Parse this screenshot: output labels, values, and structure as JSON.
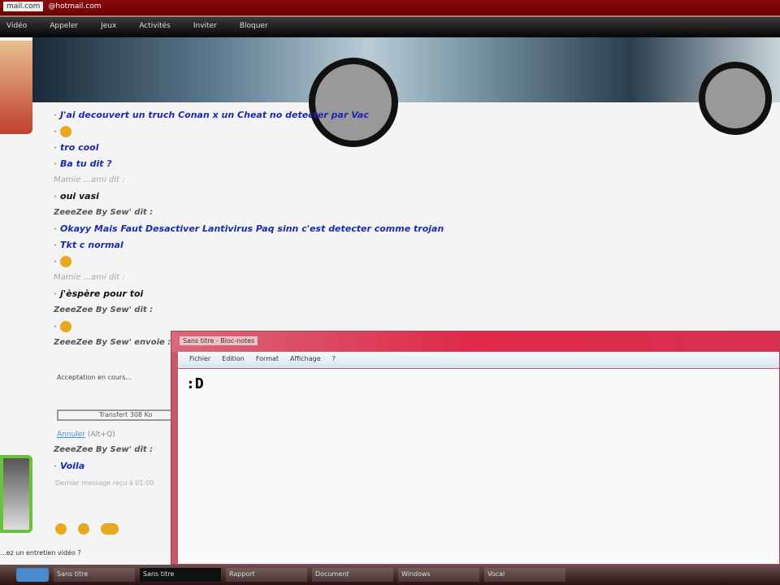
{
  "browser": {
    "tab": "mail.com",
    "url": "@hotmail.com"
  },
  "nav": [
    "Vidéo",
    "Appeler",
    "Jeux",
    "Activités",
    "Inviter",
    "Bloquer"
  ],
  "chat": [
    {
      "type": "msg",
      "text": "J'ai decouvert un truch Conan x un Cheat no detecter par Vac"
    },
    {
      "type": "emoticon"
    },
    {
      "type": "msg",
      "text": "tro cool"
    },
    {
      "type": "msg",
      "text": "Ba tu dit ?"
    },
    {
      "type": "nick",
      "text": "Mamie ...ami dit :",
      "light": true
    },
    {
      "type": "msg",
      "text": "oui vasi",
      "black": true
    },
    {
      "type": "nick",
      "text": "ZeeeZee By Sew' dit :"
    },
    {
      "type": "msg",
      "text": "Okayy Mais Faut Desactiver Lantivirus Paq sinn c'est detecter comme trojan"
    },
    {
      "type": "msg",
      "text": "Tkt c normal"
    },
    {
      "type": "emoticon"
    },
    {
      "type": "nick",
      "text": "Mamie ...ami dit :",
      "light": true
    },
    {
      "type": "msg",
      "text": "j'èspère pour toi",
      "black": true
    },
    {
      "type": "nick",
      "text": "ZeeeZee By Sew' dit :"
    },
    {
      "type": "emoticon"
    },
    {
      "type": "nick",
      "text": "ZeeeZee By Sew' envoie :"
    }
  ],
  "transfer": {
    "status": "Acceptation en cours...",
    "file": "Transfert 308 Ko",
    "cancel": "Annuler",
    "shortcut": "(Alt+Q)"
  },
  "after": [
    {
      "type": "nick",
      "text": "ZeeeZee By Sew' dit :"
    },
    {
      "type": "msg",
      "text": "Voila"
    }
  ],
  "last_message": "Dernier message reçu à 01:00",
  "footer": "...ez un entretien vidéo ?",
  "notepad": {
    "title": "Sans titre - Bloc-notes",
    "menu": [
      "Fichier",
      "Edition",
      "Format",
      "Affichage",
      "?"
    ],
    "content": ":D"
  },
  "taskbar": [
    "Sans titre",
    "Sans titre",
    "Rapport",
    "Document",
    "Windows",
    "Vocal"
  ]
}
